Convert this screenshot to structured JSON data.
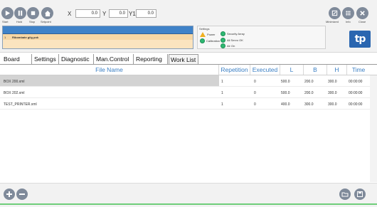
{
  "toolbar": {
    "start_label": "Start",
    "hold_label": "Hold",
    "stop_label": "Stop",
    "setpoint_label": "Setpoint",
    "x_label": "X",
    "x_value": "0.0",
    "y_label": "Y",
    "y_value": "0.0",
    "y1_label": "Y1",
    "y1_value": "0.0",
    "minimized_label": "Minimized",
    "info_label": "Info",
    "close_label": "Close"
  },
  "program_panel": {
    "rows": [
      {
        "num": "1",
        "text": "Ribombate gilg pok"
      },
      {
        "num": "",
        "text": ""
      },
      {
        "num": "",
        "text": ""
      }
    ]
  },
  "settings": {
    "title": "Settings",
    "power": "Power",
    "calibration": "Calibration",
    "security_array": "Security Array",
    "all_servo_ok": "All Servo OK",
    "air_on": "Air On"
  },
  "logo_text": "tp",
  "tabs": [
    "Board",
    "Settings",
    "Diagnostic",
    "Man.Control",
    "Reporting",
    "Work List"
  ],
  "table": {
    "headers": [
      "File Name",
      "Repetition",
      "Executed",
      "L",
      "B",
      "H",
      "Time"
    ],
    "rows": [
      [
        "BOX 200.xml",
        "1",
        "0",
        "500.0",
        "200.0",
        "300.0",
        "00:00:00"
      ],
      [
        "BOX 202.xml",
        "1",
        "0",
        "500.0",
        "200.0",
        "300.0",
        "00:00:00"
      ],
      [
        "TEST_PRINTER.xml",
        "1",
        "0",
        "400.0",
        "300.0",
        "300.0",
        "00:00:00"
      ]
    ]
  },
  "colors": {
    "accent": "#3b7fc4",
    "button": "#7f8a9a",
    "ok": "#2eb872",
    "warning": "#f0b020",
    "program_header": "#3f82c8",
    "program_row": "#fbe4bf",
    "progress_line": "#6fce7a"
  }
}
